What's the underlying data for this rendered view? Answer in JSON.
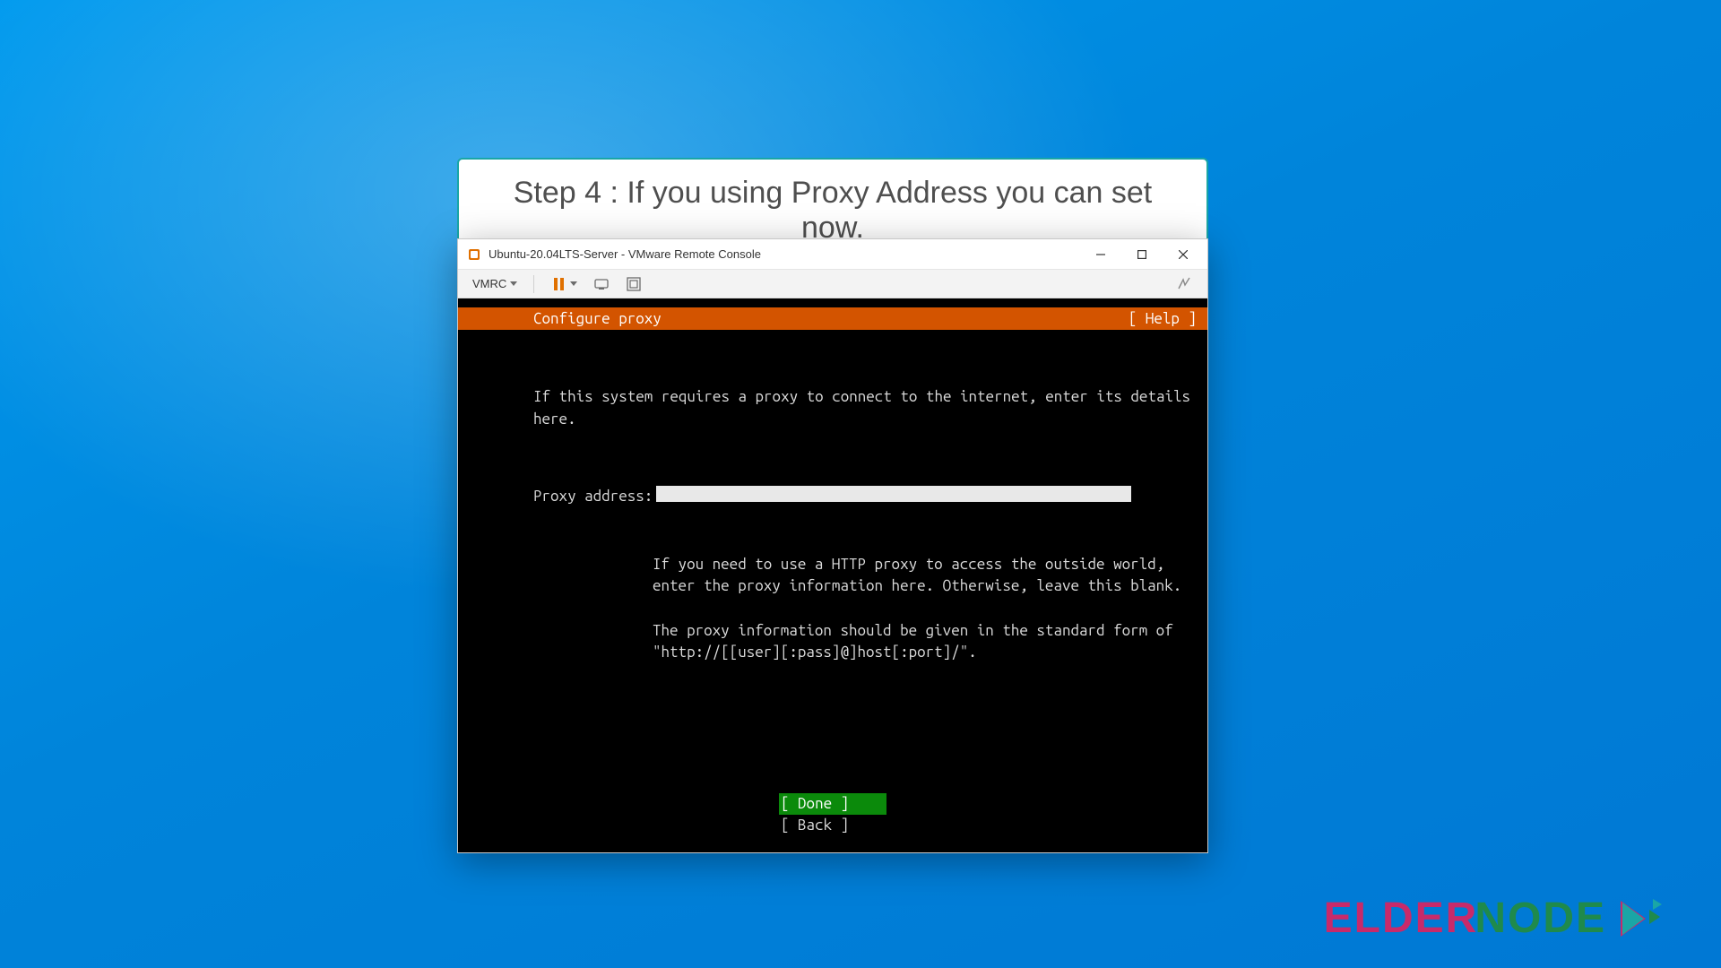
{
  "step_banner": "Step 4 : If you using Proxy Address you can set now.",
  "window": {
    "title": "Ubuntu-20.04LTS-Server - VMware Remote Console",
    "toolbar": {
      "vmrc_label": "VMRC"
    }
  },
  "installer": {
    "header_title": "Configure proxy",
    "header_help": "[ Help ]",
    "intro": "If this system requires a proxy to connect to the internet, enter its details\nhere.",
    "proxy_label": "Proxy address:",
    "proxy_value": "",
    "hint": "If you need to use a HTTP proxy to access the outside world,\nenter the proxy information here. Otherwise, leave this blank.\n\nThe proxy information should be given in the standard form of\n\"http://[[user][:pass]@]host[:port]/\".",
    "btn_done": "[ Done       ]",
    "btn_back": "[ Back       ]"
  },
  "watermark": {
    "elder": "ELDER",
    "node": "NODE"
  }
}
